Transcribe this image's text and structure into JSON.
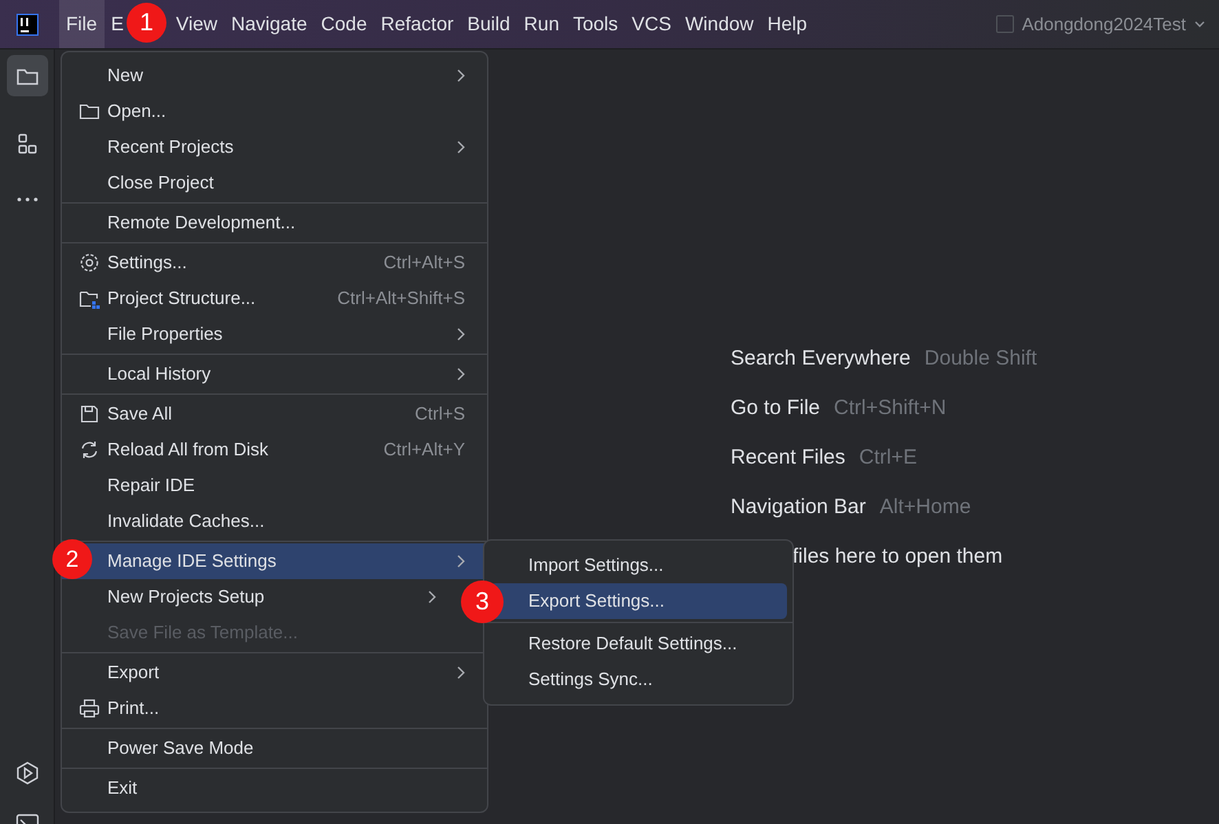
{
  "menu_bar": [
    {
      "label": "File",
      "selected": true
    },
    {
      "label": "E",
      "selected": false
    },
    {
      "label": "View",
      "selected": false
    },
    {
      "label": "Navigate",
      "selected": false
    },
    {
      "label": "Code",
      "selected": false
    },
    {
      "label": "Refactor",
      "selected": false
    },
    {
      "label": "Build",
      "selected": false
    },
    {
      "label": "Run",
      "selected": false
    },
    {
      "label": "Tools",
      "selected": false
    },
    {
      "label": "VCS",
      "selected": false
    },
    {
      "label": "Window",
      "selected": false
    },
    {
      "label": "Help",
      "selected": false
    }
  ],
  "project": {
    "name": "Adongdong2024Test"
  },
  "tool_strip": [
    {
      "kind": "folder",
      "selected": true
    },
    {
      "kind": "structure",
      "selected": false
    },
    {
      "kind": "more",
      "selected": false
    },
    {
      "kind": "run",
      "selected": false
    },
    {
      "kind": "terminal",
      "selected": false
    }
  ],
  "file_menu": [
    {
      "kind": "item",
      "label": "New",
      "submenu": true,
      "selected": false,
      "disabled": false
    },
    {
      "kind": "item",
      "label": "Open...",
      "selected": false,
      "disabled": false
    },
    {
      "kind": "item",
      "label": "Recent Projects",
      "submenu": true,
      "selected": false,
      "disabled": false
    },
    {
      "kind": "item",
      "label": "Close Project",
      "selected": false,
      "disabled": false
    },
    {
      "kind": "separator"
    },
    {
      "kind": "item",
      "label": "Remote Development...",
      "selected": false,
      "disabled": false
    },
    {
      "kind": "separator"
    },
    {
      "kind": "item",
      "label": "Settings...",
      "shortcut": "Ctrl+Alt+S",
      "selected": false,
      "disabled": false
    },
    {
      "kind": "item",
      "label": "Project Structure...",
      "shortcut": "Ctrl+Alt+Shift+S",
      "selected": false,
      "disabled": false
    },
    {
      "kind": "item",
      "label": "File Properties",
      "submenu": true,
      "selected": false,
      "disabled": false
    },
    {
      "kind": "separator"
    },
    {
      "kind": "item",
      "label": "Local History",
      "submenu": true,
      "selected": false,
      "disabled": false
    },
    {
      "kind": "separator"
    },
    {
      "kind": "item",
      "label": "Save All",
      "shortcut": "Ctrl+S",
      "selected": false,
      "disabled": false
    },
    {
      "kind": "item",
      "label": "Reload All from Disk",
      "shortcut": "Ctrl+Alt+Y",
      "selected": false,
      "disabled": false
    },
    {
      "kind": "item",
      "label": "Repair IDE",
      "selected": false,
      "disabled": false
    },
    {
      "kind": "item",
      "label": "Invalidate Caches...",
      "selected": false,
      "disabled": false
    },
    {
      "kind": "separator"
    },
    {
      "kind": "item",
      "label": "Manage IDE Settings",
      "submenu": true,
      "selected": true,
      "disabled": false
    },
    {
      "kind": "item",
      "label": "New Projects Setup",
      "submenu": true,
      "selected": false,
      "disabled": false
    },
    {
      "kind": "item",
      "label": "Save File as Template...",
      "selected": false,
      "disabled": true
    },
    {
      "kind": "separator"
    },
    {
      "kind": "item",
      "label": "Export",
      "submenu": true,
      "selected": false,
      "disabled": false
    },
    {
      "kind": "item",
      "label": "Print...",
      "selected": false,
      "disabled": false
    },
    {
      "kind": "separator"
    },
    {
      "kind": "item",
      "label": "Power Save Mode",
      "selected": false,
      "disabled": false
    },
    {
      "kind": "separator"
    },
    {
      "kind": "item",
      "label": "Exit",
      "selected": false,
      "disabled": false
    }
  ],
  "settings_submenu": [
    {
      "kind": "item",
      "label": "Import Settings...",
      "selected": false
    },
    {
      "kind": "item",
      "label": "Export Settings...",
      "selected": true
    },
    {
      "kind": "separator"
    },
    {
      "kind": "item",
      "label": "Restore Default Settings...",
      "selected": false
    },
    {
      "kind": "item",
      "label": "Settings Sync...",
      "selected": false
    }
  ],
  "welcome_hints": [
    {
      "label": "Search Everywhere",
      "shortcut": "Double Shift"
    },
    {
      "label": "Go to File",
      "shortcut": "Ctrl+Shift+N"
    },
    {
      "label": "Recent Files",
      "shortcut": "Ctrl+E"
    },
    {
      "label": "Navigation Bar",
      "shortcut": "Alt+Home"
    },
    {
      "label": "files here to open them"
    }
  ],
  "annotations": [
    "1",
    "2",
    "3"
  ]
}
